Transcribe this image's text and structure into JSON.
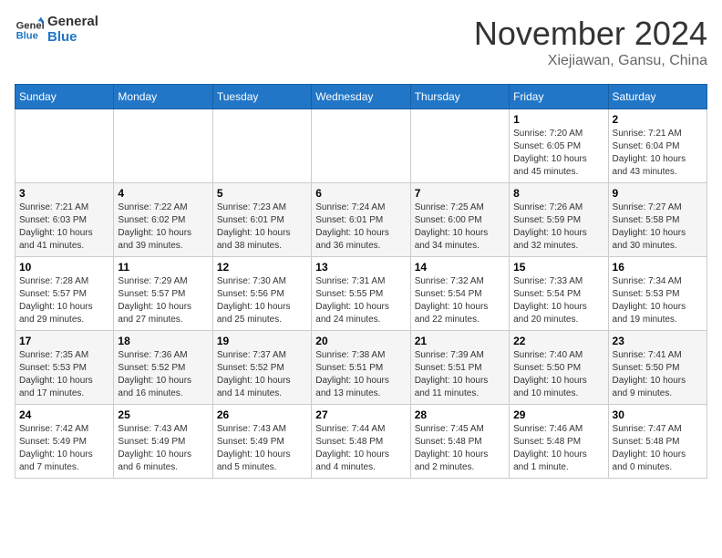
{
  "header": {
    "logo_line1": "General",
    "logo_line2": "Blue",
    "month": "November 2024",
    "location": "Xiejiawan, Gansu, China"
  },
  "weekdays": [
    "Sunday",
    "Monday",
    "Tuesday",
    "Wednesday",
    "Thursday",
    "Friday",
    "Saturday"
  ],
  "weeks": [
    [
      {
        "day": "",
        "info": ""
      },
      {
        "day": "",
        "info": ""
      },
      {
        "day": "",
        "info": ""
      },
      {
        "day": "",
        "info": ""
      },
      {
        "day": "",
        "info": ""
      },
      {
        "day": "1",
        "info": "Sunrise: 7:20 AM\nSunset: 6:05 PM\nDaylight: 10 hours\nand 45 minutes."
      },
      {
        "day": "2",
        "info": "Sunrise: 7:21 AM\nSunset: 6:04 PM\nDaylight: 10 hours\nand 43 minutes."
      }
    ],
    [
      {
        "day": "3",
        "info": "Sunrise: 7:21 AM\nSunset: 6:03 PM\nDaylight: 10 hours\nand 41 minutes."
      },
      {
        "day": "4",
        "info": "Sunrise: 7:22 AM\nSunset: 6:02 PM\nDaylight: 10 hours\nand 39 minutes."
      },
      {
        "day": "5",
        "info": "Sunrise: 7:23 AM\nSunset: 6:01 PM\nDaylight: 10 hours\nand 38 minutes."
      },
      {
        "day": "6",
        "info": "Sunrise: 7:24 AM\nSunset: 6:01 PM\nDaylight: 10 hours\nand 36 minutes."
      },
      {
        "day": "7",
        "info": "Sunrise: 7:25 AM\nSunset: 6:00 PM\nDaylight: 10 hours\nand 34 minutes."
      },
      {
        "day": "8",
        "info": "Sunrise: 7:26 AM\nSunset: 5:59 PM\nDaylight: 10 hours\nand 32 minutes."
      },
      {
        "day": "9",
        "info": "Sunrise: 7:27 AM\nSunset: 5:58 PM\nDaylight: 10 hours\nand 30 minutes."
      }
    ],
    [
      {
        "day": "10",
        "info": "Sunrise: 7:28 AM\nSunset: 5:57 PM\nDaylight: 10 hours\nand 29 minutes."
      },
      {
        "day": "11",
        "info": "Sunrise: 7:29 AM\nSunset: 5:57 PM\nDaylight: 10 hours\nand 27 minutes."
      },
      {
        "day": "12",
        "info": "Sunrise: 7:30 AM\nSunset: 5:56 PM\nDaylight: 10 hours\nand 25 minutes."
      },
      {
        "day": "13",
        "info": "Sunrise: 7:31 AM\nSunset: 5:55 PM\nDaylight: 10 hours\nand 24 minutes."
      },
      {
        "day": "14",
        "info": "Sunrise: 7:32 AM\nSunset: 5:54 PM\nDaylight: 10 hours\nand 22 minutes."
      },
      {
        "day": "15",
        "info": "Sunrise: 7:33 AM\nSunset: 5:54 PM\nDaylight: 10 hours\nand 20 minutes."
      },
      {
        "day": "16",
        "info": "Sunrise: 7:34 AM\nSunset: 5:53 PM\nDaylight: 10 hours\nand 19 minutes."
      }
    ],
    [
      {
        "day": "17",
        "info": "Sunrise: 7:35 AM\nSunset: 5:53 PM\nDaylight: 10 hours\nand 17 minutes."
      },
      {
        "day": "18",
        "info": "Sunrise: 7:36 AM\nSunset: 5:52 PM\nDaylight: 10 hours\nand 16 minutes."
      },
      {
        "day": "19",
        "info": "Sunrise: 7:37 AM\nSunset: 5:52 PM\nDaylight: 10 hours\nand 14 minutes."
      },
      {
        "day": "20",
        "info": "Sunrise: 7:38 AM\nSunset: 5:51 PM\nDaylight: 10 hours\nand 13 minutes."
      },
      {
        "day": "21",
        "info": "Sunrise: 7:39 AM\nSunset: 5:51 PM\nDaylight: 10 hours\nand 11 minutes."
      },
      {
        "day": "22",
        "info": "Sunrise: 7:40 AM\nSunset: 5:50 PM\nDaylight: 10 hours\nand 10 minutes."
      },
      {
        "day": "23",
        "info": "Sunrise: 7:41 AM\nSunset: 5:50 PM\nDaylight: 10 hours\nand 9 minutes."
      }
    ],
    [
      {
        "day": "24",
        "info": "Sunrise: 7:42 AM\nSunset: 5:49 PM\nDaylight: 10 hours\nand 7 minutes."
      },
      {
        "day": "25",
        "info": "Sunrise: 7:43 AM\nSunset: 5:49 PM\nDaylight: 10 hours\nand 6 minutes."
      },
      {
        "day": "26",
        "info": "Sunrise: 7:43 AM\nSunset: 5:49 PM\nDaylight: 10 hours\nand 5 minutes."
      },
      {
        "day": "27",
        "info": "Sunrise: 7:44 AM\nSunset: 5:48 PM\nDaylight: 10 hours\nand 4 minutes."
      },
      {
        "day": "28",
        "info": "Sunrise: 7:45 AM\nSunset: 5:48 PM\nDaylight: 10 hours\nand 2 minutes."
      },
      {
        "day": "29",
        "info": "Sunrise: 7:46 AM\nSunset: 5:48 PM\nDaylight: 10 hours\nand 1 minute."
      },
      {
        "day": "30",
        "info": "Sunrise: 7:47 AM\nSunset: 5:48 PM\nDaylight: 10 hours\nand 0 minutes."
      }
    ]
  ]
}
